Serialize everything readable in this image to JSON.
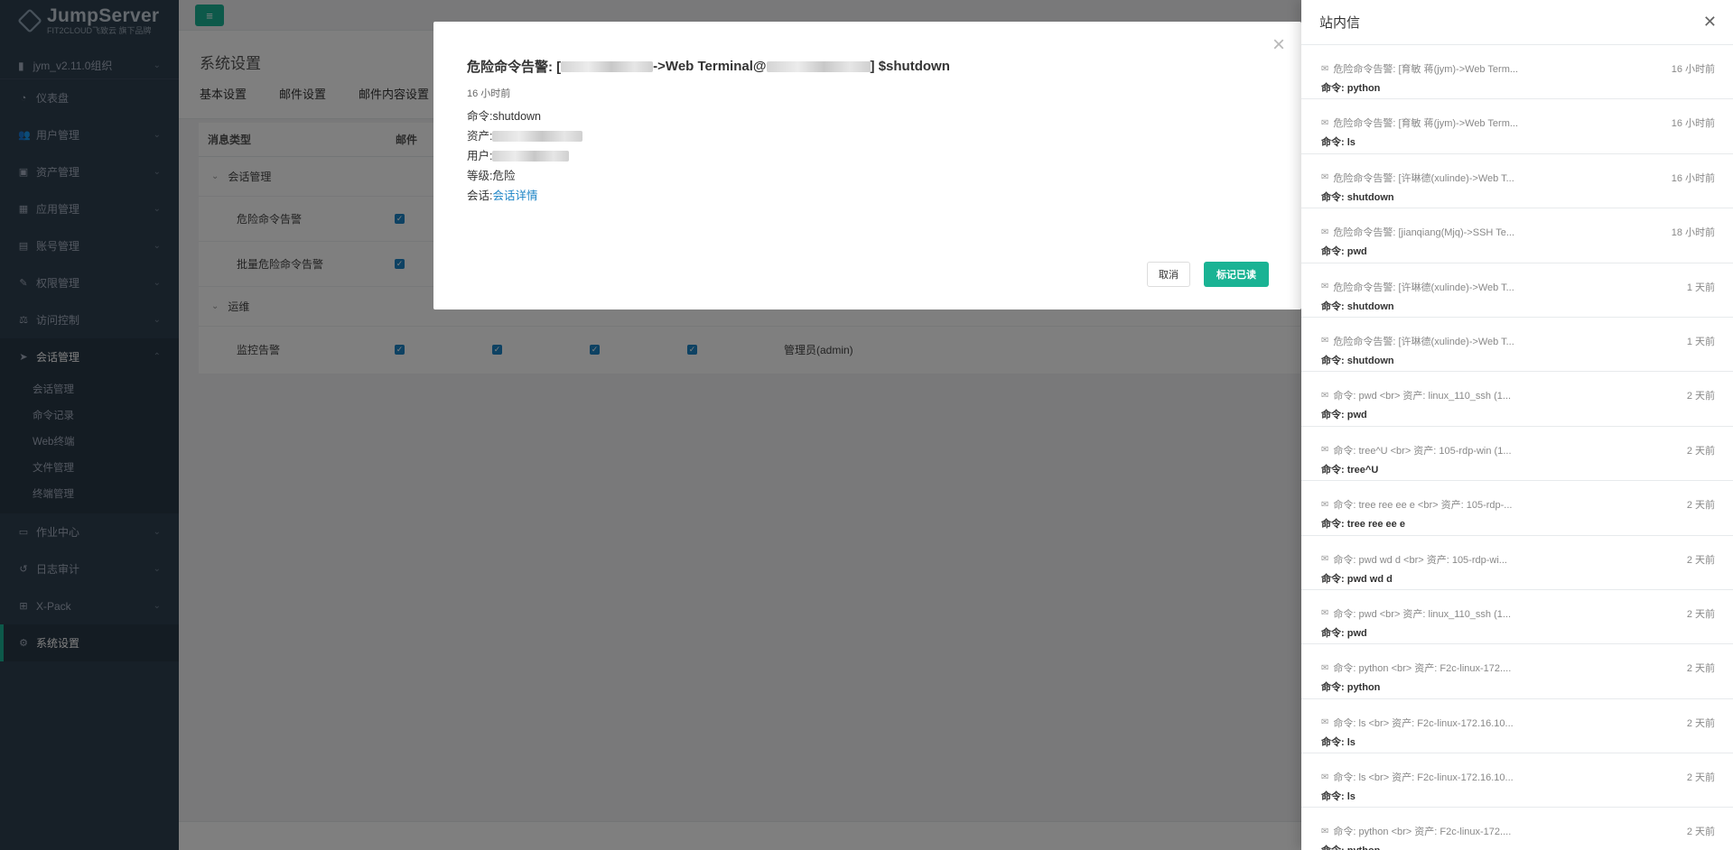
{
  "app": {
    "logo_title": "JumpServer",
    "logo_sub": "FIT2CLOUD飞致云 旗下品牌",
    "org": "jym_v2.11.0组织"
  },
  "sidebar": {
    "items": [
      {
        "label": "仪表盘",
        "icon": "dashboard-icon",
        "glyph": "◔"
      },
      {
        "label": "用户管理",
        "icon": "users-icon",
        "glyph": "👥"
      },
      {
        "label": "资产管理",
        "icon": "inbox-icon",
        "glyph": "▣"
      },
      {
        "label": "应用管理",
        "icon": "grid-icon",
        "glyph": "▦"
      },
      {
        "label": "账号管理",
        "icon": "address-book-icon",
        "glyph": "▤"
      },
      {
        "label": "权限管理",
        "icon": "edit-icon",
        "glyph": "✎"
      },
      {
        "label": "访问控制",
        "icon": "sitemap-icon",
        "glyph": "⚖"
      }
    ],
    "open_group": {
      "label": "会话管理",
      "icon": "rocket-icon",
      "glyph": "➤"
    },
    "sub_items": [
      "会话管理",
      "命令记录",
      "Web终端",
      "文件管理",
      "终端管理"
    ],
    "after_items": [
      {
        "label": "作业中心",
        "icon": "laptop-icon",
        "glyph": "▭"
      },
      {
        "label": "日志审计",
        "icon": "history-icon",
        "glyph": "↺"
      },
      {
        "label": "X-Pack",
        "icon": "sitemap-icon",
        "glyph": "⊞"
      }
    ],
    "active_item": {
      "label": "系统设置",
      "icon": "gears-icon",
      "glyph": "⚙"
    }
  },
  "page": {
    "title": "系统设置",
    "tabs": [
      "基本设置",
      "邮件设置",
      "邮件内容设置"
    ]
  },
  "table": {
    "headers": [
      "消息类型",
      "邮件"
    ],
    "groups": [
      {
        "label": "会话管理",
        "rows": [
          "危险命令告警",
          "批量危险命令告警"
        ]
      },
      {
        "label": "运维",
        "rows": [
          "监控告警"
        ],
        "receiver": "管理员(admin)"
      }
    ]
  },
  "modal": {
    "title_prefix": "危险命令告警: [",
    "title_mid": "->Web Terminal@",
    "title_suffix": "] $shutdown",
    "time": "16 小时前",
    "command_label": "命令: ",
    "command_value": "shutdown",
    "asset_label": "资产: ",
    "user_label": "用户: ",
    "level_label": "等级: ",
    "level_value": "危险",
    "session_label": "会话: ",
    "session_link": "会话详情",
    "cancel": "取消",
    "mark_read": "标记已读"
  },
  "drawer": {
    "title": "站内信",
    "messages": [
      {
        "head": "危险命令告警: [育敏 蒋(jym)->Web Term...",
        "time": "16 小时前",
        "cmd": "命令: python"
      },
      {
        "head": "危险命令告警: [育敏 蒋(jym)->Web Term...",
        "time": "16 小时前",
        "cmd": "命令: ls"
      },
      {
        "head": "危险命令告警: [许琳德(xulinde)->Web T...",
        "time": "16 小时前",
        "cmd": "命令: shutdown"
      },
      {
        "head": "危险命令告警: [jianqiang(Mjq)->SSH Te...",
        "time": "18 小时前",
        "cmd": "命令: pwd"
      },
      {
        "head": "危险命令告警: [许琳德(xulinde)->Web T...",
        "time": "1 天前",
        "cmd": "命令: shutdown"
      },
      {
        "head": "危险命令告警: [许琳德(xulinde)->Web T...",
        "time": "1 天前",
        "cmd": "命令: shutdown"
      },
      {
        "head": "命令: pwd <br> 资产: linux_110_ssh (1...",
        "time": "2 天前",
        "cmd": "命令: pwd"
      },
      {
        "head": "命令: tree^U <br> 资产: 105-rdp-win (1...",
        "time": "2 天前",
        "cmd": "命令: tree^U"
      },
      {
        "head": "命令: tree ree ee e <br> 资产: 105-rdp-...",
        "time": "2 天前",
        "cmd": "命令: tree ree ee e"
      },
      {
        "head": "命令: pwd wd d <br> 资产: 105-rdp-wi...",
        "time": "2 天前",
        "cmd": "命令: pwd wd d"
      },
      {
        "head": "命令: pwd <br> 资产: linux_110_ssh (1...",
        "time": "2 天前",
        "cmd": "命令: pwd"
      },
      {
        "head": "命令: python <br> 资产: F2c-linux-172....",
        "time": "2 天前",
        "cmd": "命令: python"
      },
      {
        "head": "命令: ls <br> 资产: F2c-linux-172.16.10...",
        "time": "2 天前",
        "cmd": "命令: ls"
      },
      {
        "head": "命令: ls <br> 资产: F2c-linux-172.16.10...",
        "time": "2 天前",
        "cmd": "命令: ls"
      },
      {
        "head": "命令: python <br> 资产: F2c-linux-172....",
        "time": "2 天前",
        "cmd": "命令: python"
      }
    ]
  },
  "colors": {
    "accent": "#1ab394",
    "sidebar_bg": "#2f4050",
    "link": "#1c84c6"
  }
}
